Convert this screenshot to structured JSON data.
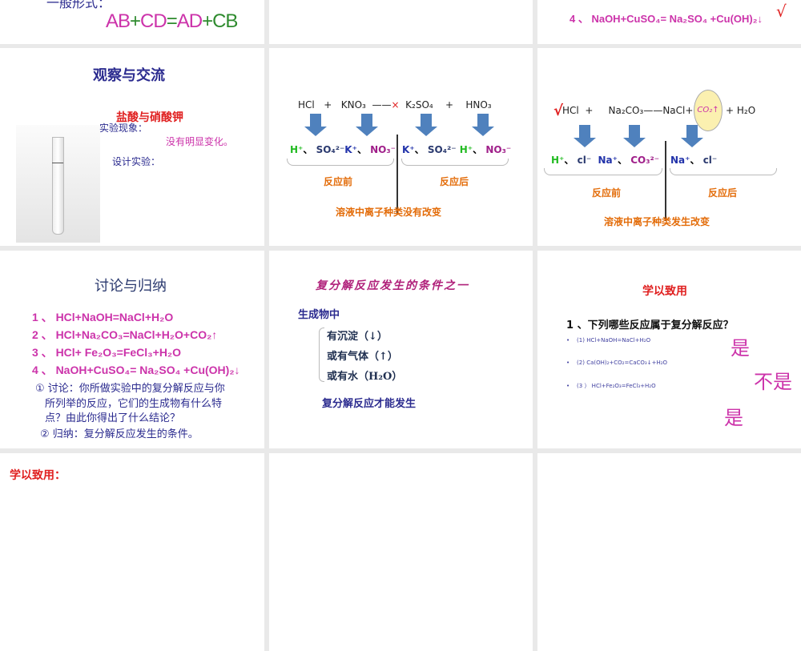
{
  "slides": {
    "s1": {
      "partial_text": "一般形式：",
      "formula_parts": [
        "AB",
        "+",
        "CD",
        "=",
        "AD",
        "+",
        "CB"
      ]
    },
    "s3": {
      "eq4": "4 、 NaOH+CuSO₄= Na₂SO₄ +Cu(OH)₂↓",
      "check": "√"
    },
    "s4": {
      "title": "观察与交流",
      "subtitle": "盐酸与硝酸钾",
      "phenomenon_label": "实验现象：",
      "phenomenon": "没有明显变化。",
      "design": "设计实验："
    },
    "s5": {
      "equation": {
        "r1": "HCl",
        "plus1": "+",
        "r2": "KNO₃",
        "arrow": "——",
        "cross": "×",
        "p1": "K₂SO₄",
        "plus2": "+",
        "p2": "HNO₃"
      },
      "ions_before": [
        "H⁺",
        "、",
        "SO₄²⁻",
        "K⁺",
        "、",
        "NO₃⁻"
      ],
      "ions_after": [
        "K⁺",
        "、",
        "SO₄²⁻",
        "H⁺",
        "、",
        "NO₃⁻"
      ],
      "before": "反应前",
      "after": "反应后",
      "conclusion": "溶液中离子种类没有改变"
    },
    "s6": {
      "check": "√",
      "equation": {
        "r1": "HCl",
        "plus1": "+",
        "r2": "Na₂CO₃",
        "arrow": "——",
        "p1": "NaCl+",
        "bubble": "CO₂↑",
        "p2": "+ H₂O"
      },
      "ions_before": [
        "H⁺",
        "、",
        "cl⁻",
        "Na⁺",
        "、",
        "CO₃²⁻"
      ],
      "ions_after": [
        "Na⁺",
        "、",
        "cl⁻"
      ],
      "before": "反应前",
      "after": "反应后",
      "conclusion": "溶液中离子种类发生改变"
    },
    "s7": {
      "title": "讨论与归纳",
      "equations": [
        "1 、 HCl+NaOH=NaCl+H₂O",
        "2 、 HCl+Na₂CO₃=NaCl+H₂O+CO₂↑",
        "3 、 HCl+ Fe₂O₃=FeCl₃+H₂O",
        "4 、 NaOH+CuSO₄= Na₂SO₄ +Cu(OH)₂↓"
      ],
      "discussion": [
        "① 讨论：你所做实验中的复分解反应与你",
        "所列举的反应，它们的生成物有什么特",
        "点？由此你得出了什么结论？"
      ],
      "summary": "② 归纳：复分解反应发生的条件。"
    },
    "s8": {
      "title": "复分解反应发生的条件之一",
      "lead": "生成物中",
      "items": [
        "有沉淀（↓）",
        "或有气体（↑）",
        "或有水（H₂O）"
      ],
      "conclusion": "复分解反应才能发生"
    },
    "s9": {
      "title": "学以致用",
      "question": "1 、下列哪些反应属于复分解反应？",
      "bullet": "•",
      "options": [
        "(1)  HCl+NaOH=NaCl+H₂O",
        "(2)  Ca(OH)₂+CO₂=CaCO₃↓+H₂O",
        "(3 ）  HCl+Fe₂O₃=FeCl₃+H₂O"
      ],
      "answers": [
        "是",
        "不是",
        "是"
      ]
    },
    "s10": {
      "title": "学以致用："
    }
  },
  "colors": {
    "pink": "#cc33aa",
    "green": "#2e8b2e",
    "navy": "#2b2b8f",
    "orange": "#e36c09",
    "red": "#e02020",
    "arrow": "#4f81bd"
  }
}
